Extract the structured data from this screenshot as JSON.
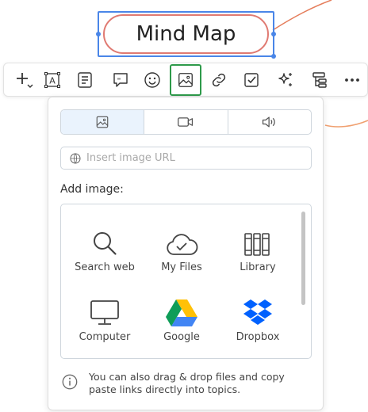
{
  "mindmap": {
    "central_topic": "Mind Map",
    "branch_color": "#e57d5b",
    "node_border_color": "#e07a72",
    "selection_color": "#4a86e8"
  },
  "toolbar": {
    "tools": [
      {
        "id": "add",
        "icon": "plus-icon"
      },
      {
        "id": "text",
        "icon": "text-frame-icon"
      },
      {
        "id": "note",
        "icon": "note-icon"
      },
      {
        "id": "comment",
        "icon": "comment-icon"
      },
      {
        "id": "emoji",
        "icon": "smiley-icon"
      },
      {
        "id": "image",
        "icon": "image-icon",
        "active": true
      },
      {
        "id": "link",
        "icon": "link-icon"
      },
      {
        "id": "task",
        "icon": "checkbox-icon"
      },
      {
        "id": "ai",
        "icon": "sparkle-icon"
      },
      {
        "id": "structure",
        "icon": "structure-icon"
      },
      {
        "id": "more",
        "icon": "more-icon"
      }
    ],
    "active_color": "#2e9a4a"
  },
  "image_panel": {
    "tabs": [
      {
        "id": "image",
        "icon": "image-icon",
        "active": true
      },
      {
        "id": "video",
        "icon": "video-camera-icon"
      },
      {
        "id": "audio",
        "icon": "speaker-icon"
      }
    ],
    "url_placeholder": "Insert image URL",
    "add_label": "Add image:",
    "sources": [
      {
        "label": "Search web",
        "icon": "search-icon"
      },
      {
        "label": "My Files",
        "icon": "cloud-check-icon"
      },
      {
        "label": "Library",
        "icon": "books-icon"
      },
      {
        "label": "Computer",
        "icon": "monitor-icon"
      },
      {
        "label": "Google",
        "icon": "google-drive-icon"
      },
      {
        "label": "Dropbox",
        "icon": "dropbox-icon"
      }
    ],
    "hint": "You can also drag & drop files and copy paste links directly into topics."
  }
}
